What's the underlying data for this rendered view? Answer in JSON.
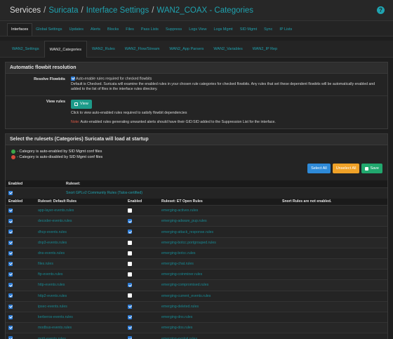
{
  "breadcrumb": [
    "Services",
    "Suricata",
    "Interface Settings",
    "WAN2_COAX - Categories"
  ],
  "main_tabs": [
    "Interfaces",
    "Global Settings",
    "Updates",
    "Alerts",
    "Blocks",
    "Files",
    "Pass Lists",
    "Suppress",
    "Logs View",
    "Logs Mgmt",
    "SID Mgmt",
    "Sync",
    "IP Lists"
  ],
  "sub_tabs": [
    "WAN2_Settings",
    "WAN2_Categories",
    "WAN2_Rules",
    "WAN2_Flow/Stream",
    "WAN2_App Parsers",
    "WAN2_Variables",
    "WAN2_IP Rep"
  ],
  "flowbit": {
    "title": "Automatic flowbit resolution",
    "resolve_label": "Resolve Flowbits",
    "resolve_checkbox": "Auto-enable rules required for checked flowbits",
    "resolve_help": "Default is Checked. Suricata will examine the enabled rules in your chosen rule categories for checked flowbits. Any rules that set these dependent flowbits will be automatically enabled and added to the list of files in the interface rules directory.",
    "view_label": "View rules",
    "view_button": "View",
    "view_help": "Click to view auto-enabled rules required to satisfy flowbit dependencies",
    "note_label": "Note:",
    "note_text": " Auto-enabled rules generating unwanted alerts should have their GID:SID added to the Suppression List for the interface."
  },
  "rulesets": {
    "title": "Select the rulesets (Categories) Suricata will load at startup",
    "legend_green": "- Category is auto-enabled by SID Mgmt conf files",
    "legend_red": "- Category is auto-disabled by SID Mgmt conf files",
    "btn_select_all": "Select All",
    "btn_unselect_all": "Unselect All",
    "btn_save": "Save",
    "top_enabled": "Enabled",
    "top_ruleset": "Ruleset:",
    "community_rule": "Snort GPLv2 Community Rules (Talos-certified)",
    "col_enabled": "Enabled",
    "col_default": "Ruleset: Default Rules",
    "col_enabled2": "Enabled",
    "col_et": "Ruleset: ET Open Rules",
    "col_snort": "Snort Rules are not enabled.",
    "rows": [
      {
        "a": "app-layer-events.rules",
        "a_on": true,
        "b": "emerging-activex.rules",
        "b_on": false
      },
      {
        "a": "decoder-events.rules",
        "a_on": true,
        "b": "emerging-adware_pup.rules",
        "b_on": true
      },
      {
        "a": "dhcp-events.rules",
        "a_on": true,
        "b": "emerging-attack_response.rules",
        "b_on": true
      },
      {
        "a": "dnp3-events.rules",
        "a_on": true,
        "b": "emerging-botcc.portgrouped.rules",
        "b_on": false
      },
      {
        "a": "dns-events.rules",
        "a_on": true,
        "b": "emerging-botcc.rules",
        "b_on": false
      },
      {
        "a": "files.rules",
        "a_on": true,
        "b": "emerging-chat.rules",
        "b_on": false
      },
      {
        "a": "ftp-events.rules",
        "a_on": true,
        "b": "emerging-coinminer.rules",
        "b_on": false
      },
      {
        "a": "http-events.rules",
        "a_on": true,
        "b": "emerging-compromised.rules",
        "b_on": true
      },
      {
        "a": "http2-events.rules",
        "a_on": true,
        "b": "emerging-current_events.rules",
        "b_on": false
      },
      {
        "a": "ipsec-events.rules",
        "a_on": true,
        "b": "emerging-deleted.rules",
        "b_on": true
      },
      {
        "a": "kerberos-events.rules",
        "a_on": true,
        "b": "emerging-dns.rules",
        "b_on": true
      },
      {
        "a": "modbus-events.rules",
        "a_on": true,
        "b": "emerging-dos.rules",
        "b_on": true
      },
      {
        "a": "mqtt-events.rules",
        "a_on": true,
        "b": "emerging-exploit.rules",
        "b_on": true
      }
    ]
  }
}
